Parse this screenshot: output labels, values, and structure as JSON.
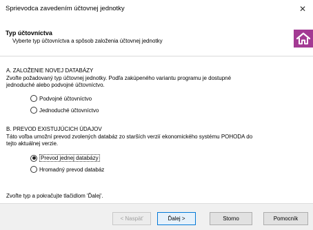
{
  "window": {
    "title": "Sprievodca zavedením účtovnej jednotky",
    "close_glyph": "✕"
  },
  "header": {
    "title": "Typ účtovníctva",
    "subtitle": "Vyberte typ účtovníctva a spôsob založenia účtovnej jednotky",
    "logo_icon": "home-icon",
    "logo_color": "#a33a93"
  },
  "section_a": {
    "title": "A. ZALOŽENIE NOVEJ DATABÁZY",
    "desc_line1": "Zvoľte požadovaný typ účtovnej jednotky. Podľa zakúpeného variantu programu je dostupné",
    "desc_line2": "jednoduché alebo podvojné účtovníctvo.",
    "options": [
      {
        "label": "Podvojné účtovníctvo",
        "selected": false
      },
      {
        "label": "Jednoduché účtovníctvo",
        "selected": false
      }
    ]
  },
  "section_b": {
    "title": "B. PREVOD EXISTUJÚCICH ÚDAJOV",
    "desc_line1": "Táto voľba umožní prevod zvolených databáz zo starších verzií ekonomického systému POHODA do",
    "desc_line2": "tejto aktuálnej verzie.",
    "options": [
      {
        "label": "Prevod jednej databázy",
        "selected": true
      },
      {
        "label": "Hromadný prevod databáz",
        "selected": false
      }
    ]
  },
  "hint": "Zvoľte typ a pokračujte tlačidlom 'Ďalej'.",
  "buttons": {
    "back": "< Naspäť",
    "next": "Ďalej >",
    "cancel": "Storno",
    "help": "Pomocník"
  }
}
